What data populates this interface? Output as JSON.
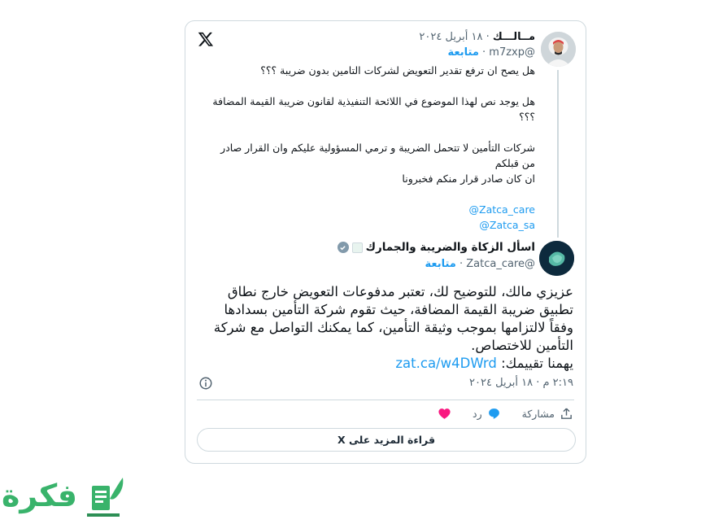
{
  "quoted_tweet": {
    "display_name": "مــالـــك",
    "date": "١٨ أبريل ٢٠٢٤",
    "handle": "@m7zxp",
    "follow_label": "متابعة",
    "paragraphs": [
      "هل يصح ان ترفع تقدير التعويض لشركات التامين بدون ضريبة ؟؟؟",
      "هل يوجد نص لهذا الموضوع في اللائحة التنفيذية لقانون ضريبة القيمة المضافة ؟؟؟",
      "شركات التأمين لا تتحمل الضريبة و ترمي المسؤولية عليكم وان القرار صادر من قبلكم",
      "ان كان صادر قرار منكم فخبرونا"
    ],
    "mentions": [
      "@Zatca_care",
      "@Zatca_sa"
    ]
  },
  "reply_tweet": {
    "display_name": "اسأل الزكاة والضريبة والجمارك",
    "handle": "@Zatca_care",
    "follow_label": "متابعة",
    "text": "عزيزي مالك، للتوضيح لك، تعتبر مدفوعات التعويض خارج نطاق تطبيق ضريبة القيمة المضافة، حيث تقوم شركة التأمين بسدادها وفقاً لالتزامها بموجب وثيقة التأمين، كما يمكنك التواصل مع شركة التأمين للاختصاص.",
    "rating_prefix": "يهمنا تقييمك:",
    "rating_link": "zat.ca/w4DWrd",
    "timestamp": "٢:١٩ م · ١٨ أبريل ٢٠٢٤"
  },
  "actions": {
    "like": "",
    "reply": "رد",
    "share": "مشاركة"
  },
  "read_more_label": "قراءة المزيد على X",
  "brand_text": "فكرة",
  "icons": [
    "x-logo-icon",
    "verified-badge-icon",
    "affiliate-badge-icon",
    "info-icon",
    "heart-icon",
    "reply-icon",
    "share-icon"
  ],
  "colors": {
    "accent": "#1d9bf0",
    "like": "#f91880",
    "brand": "#39b36b",
    "border": "#cfd9de"
  }
}
